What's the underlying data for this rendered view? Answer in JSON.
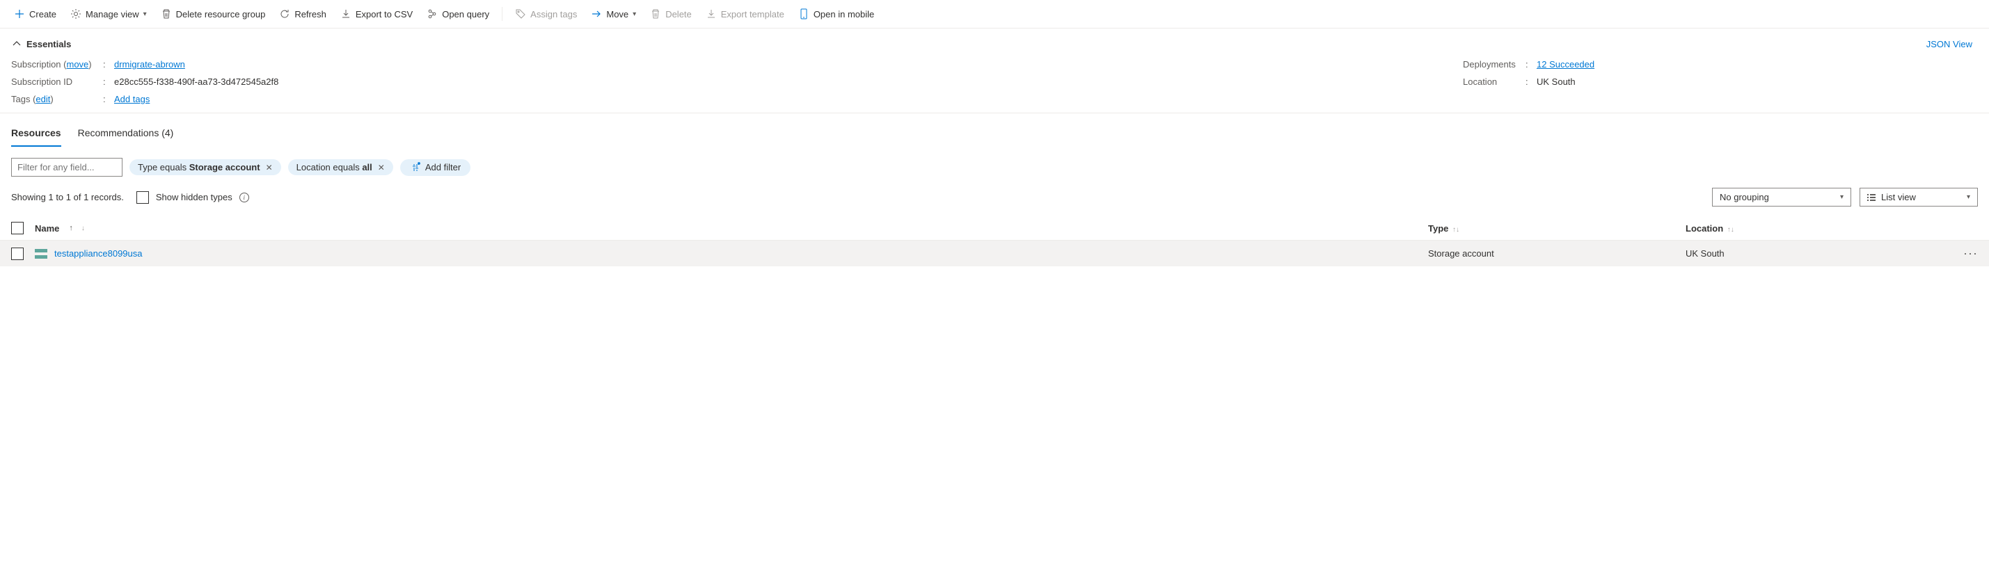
{
  "toolbar": {
    "create": "Create",
    "manage_view": "Manage view",
    "delete_rg": "Delete resource group",
    "refresh": "Refresh",
    "export_csv": "Export to CSV",
    "open_query": "Open query",
    "assign_tags": "Assign tags",
    "move": "Move",
    "delete": "Delete",
    "export_template": "Export template",
    "open_mobile": "Open in mobile"
  },
  "essentials": {
    "header": "Essentials",
    "json_view": "JSON View",
    "subscription_label": "Subscription",
    "move_label": "move",
    "subscription_value": "drmigrate-abrown",
    "subscription_id_label": "Subscription ID",
    "subscription_id_value": "e28cc555-f338-490f-aa73-3d472545a2f8",
    "tags_label": "Tags",
    "edit_label": "edit",
    "add_tags": "Add tags",
    "deployments_label": "Deployments",
    "deployments_value": "12 Succeeded",
    "location_label": "Location",
    "location_value": "UK South"
  },
  "tabs": {
    "resources": "Resources",
    "recommendations": "Recommendations (4)"
  },
  "filters": {
    "input_placeholder": "Filter for any field...",
    "type_prefix": "Type equals ",
    "type_value": "Storage account",
    "location_prefix": "Location equals ",
    "location_value": "all",
    "add_filter": "Add filter"
  },
  "records": {
    "showing": "Showing 1 to 1 of 1 records.",
    "show_hidden": "Show hidden types",
    "grouping": "No grouping",
    "view_mode": "List view"
  },
  "table": {
    "headers": {
      "name": "Name",
      "type": "Type",
      "location": "Location"
    },
    "rows": [
      {
        "name": "testappliance8099usa",
        "type": "Storage account",
        "location": "UK South"
      }
    ]
  }
}
